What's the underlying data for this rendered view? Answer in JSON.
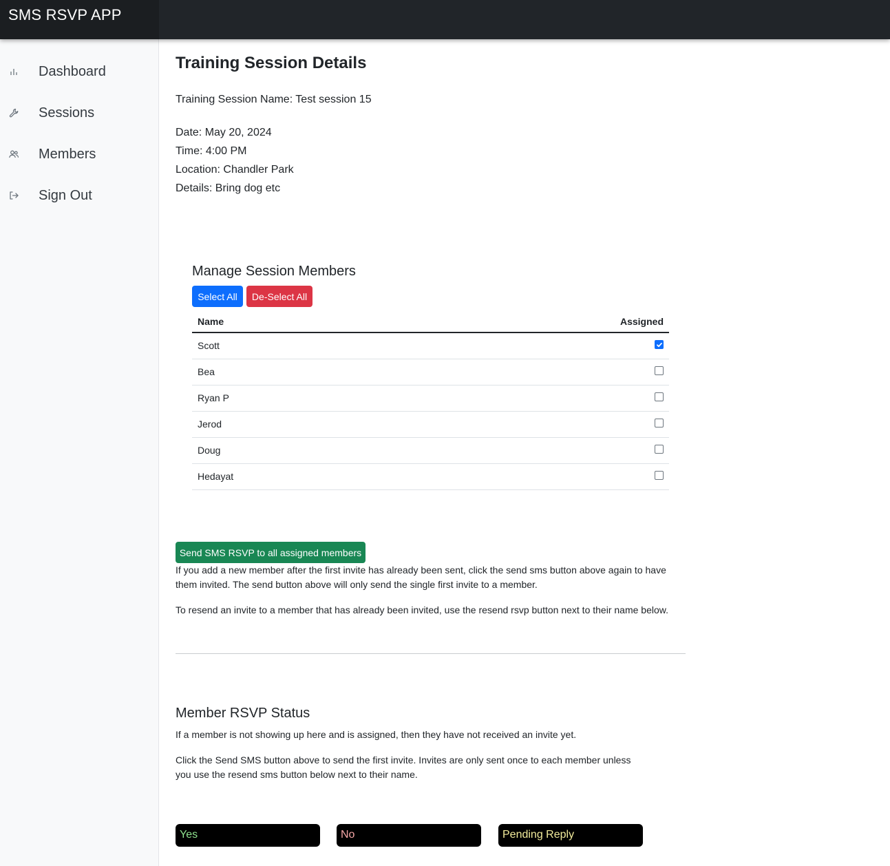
{
  "app": {
    "title": "SMS RSVP APP"
  },
  "sidebar": {
    "items": [
      {
        "label": "Dashboard",
        "icon": "bar-chart-icon"
      },
      {
        "label": "Sessions",
        "icon": "wrench-icon"
      },
      {
        "label": "Members",
        "icon": "people-icon"
      },
      {
        "label": "Sign Out",
        "icon": "sign-out-icon"
      }
    ]
  },
  "session": {
    "heading": "Training Session Details",
    "name_line": "Training Session Name: Test session 15",
    "date_line": "Date: May 20, 2024",
    "time_line": "Time: 4:00 PM",
    "location_line": "Location: Chandler Park",
    "details_line": "Details: Bring dog etc"
  },
  "members": {
    "heading": "Manage Session Members",
    "select_all_label": "Select All",
    "deselect_all_label": "De-Select All",
    "columns": [
      "Name",
      "Assigned"
    ],
    "rows": [
      {
        "name": "Scott",
        "assigned": true
      },
      {
        "name": "Bea",
        "assigned": false
      },
      {
        "name": "Ryan P",
        "assigned": false
      },
      {
        "name": "Jerod",
        "assigned": false
      },
      {
        "name": "Doug",
        "assigned": false
      },
      {
        "name": "Hedayat",
        "assigned": false
      }
    ]
  },
  "send": {
    "button_label": "Send SMS RSVP to all assigned members",
    "note_1": "If you add a new member after the first invite has already been sent, click the send sms button above again to have them invited. The send button above will only send the single first invite to a member.",
    "note_2": "To resend an invite to a member that has already been invited, use the resend rsvp button next to their name below."
  },
  "rsvp_status": {
    "heading": "Member RSVP Status",
    "note_1": "If a member is not showing up here and is assigned, then they have not received an invite yet.",
    "note_2": "Click the Send SMS button above to send the first invite. Invites are only sent once to each member unless you use the resend sms button below next to their name.",
    "columns": [
      {
        "label": "Yes",
        "color": "#8fe38f"
      },
      {
        "label": "No",
        "color": "#f4a6a6"
      },
      {
        "label": "Pending Reply",
        "color": "#f3ec9c"
      }
    ]
  },
  "colors": {
    "primary": "#0d6efd",
    "danger": "#dc3545",
    "success": "#198754",
    "navbar": "#212529"
  }
}
